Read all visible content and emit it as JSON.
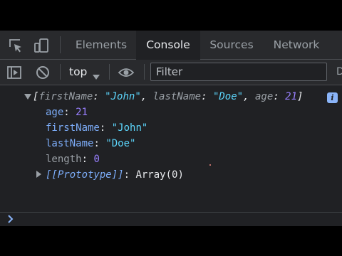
{
  "tabs": [
    {
      "label": "Elements",
      "active": false
    },
    {
      "label": "Console",
      "active": true
    },
    {
      "label": "Sources",
      "active": false
    },
    {
      "label": "Network",
      "active": false
    }
  ],
  "toolbar": {
    "context": "top",
    "filter_placeholder": "Filter",
    "edge_glyph": "D"
  },
  "console": {
    "summary": {
      "open_bracket": "[",
      "first_key": "firstName",
      "first_val": "\"John\"",
      "second_key": "lastName",
      "second_val": "\"Doe\"",
      "third_key": "age",
      "third_val": "21",
      "close_bracket": "]",
      "badge": "i"
    },
    "props": {
      "age_key": "age",
      "age_val": "21",
      "first_key": "firstName",
      "first_val": "\"John\"",
      "last_key": "lastName",
      "last_val": "\"Doe\"",
      "length_key": "length",
      "length_val": "0",
      "proto_key": "[[Prototype]]",
      "proto_val": "Array(0)"
    },
    "colon": ":",
    "comma": ","
  },
  "colors": {
    "panel_bg": "#202124",
    "toolbar_bg": "#292a2d",
    "key_blue": "#7cacf8",
    "string_cyan": "#5cd5fb",
    "number_purple": "#9980ff",
    "prompt_blue": "#8ab4f8"
  }
}
